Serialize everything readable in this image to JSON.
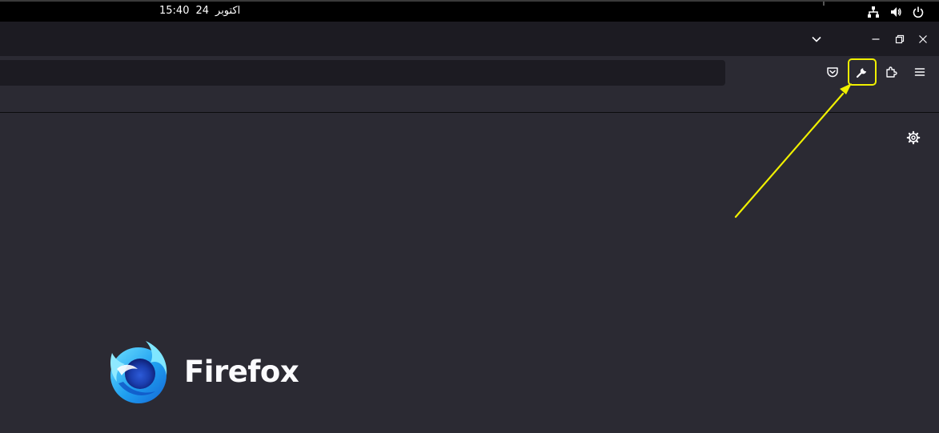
{
  "system_bar": {
    "time": "15:40",
    "date_day": "24",
    "date_month": "اكتوبر",
    "tray_icons": [
      "network-icon",
      "volume-icon",
      "power-icon"
    ]
  },
  "window": {
    "controls": [
      "list-all-tabs-icon",
      "minimize-icon",
      "restore-icon",
      "close-icon"
    ]
  },
  "toolbar": {
    "buttons": [
      "pocket-icon",
      "wrench-icon",
      "extensions-icon",
      "menu-icon"
    ],
    "highlighted_button": "wrench-icon",
    "highlight_color": "#f0f000"
  },
  "newtab": {
    "brand": "Firefox",
    "settings_icon": "gear-icon"
  },
  "colors": {
    "content_bg": "#2b2a33",
    "tabstrip_bg": "#1c1b22",
    "annotation": "#f0f000"
  }
}
